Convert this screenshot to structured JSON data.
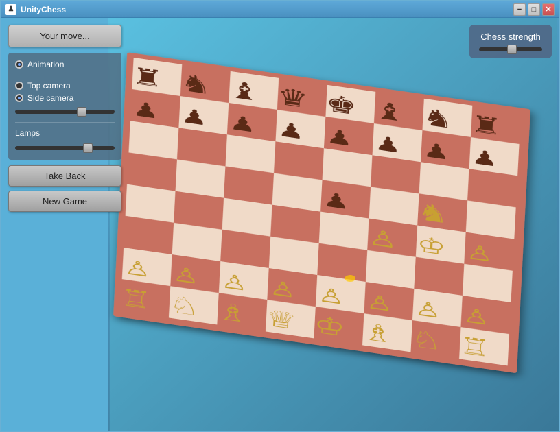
{
  "window": {
    "title": "UnityChess",
    "icon": "♟",
    "controls": {
      "minimize": "−",
      "maximize": "□",
      "close": "✕"
    }
  },
  "left_panel": {
    "your_move_label": "Your move...",
    "animation_label": "Animation",
    "top_camera_label": "Top camera",
    "side_camera_label": "Side camera",
    "lamps_label": "Lamps",
    "take_back_label": "Take Back",
    "new_game_label": "New Game"
  },
  "strength_panel": {
    "title": "Chess strength",
    "slider_value": 45
  },
  "board": {
    "colors": {
      "light_square": "#f0dac8",
      "dark_square": "#c87060",
      "border": "#c87060",
      "background_gradient_start": "#5ac0e0",
      "background_gradient_end": "#3a7898"
    }
  },
  "sliders": {
    "camera_value": 65,
    "lamps_value": 70,
    "strength_value": 45
  }
}
